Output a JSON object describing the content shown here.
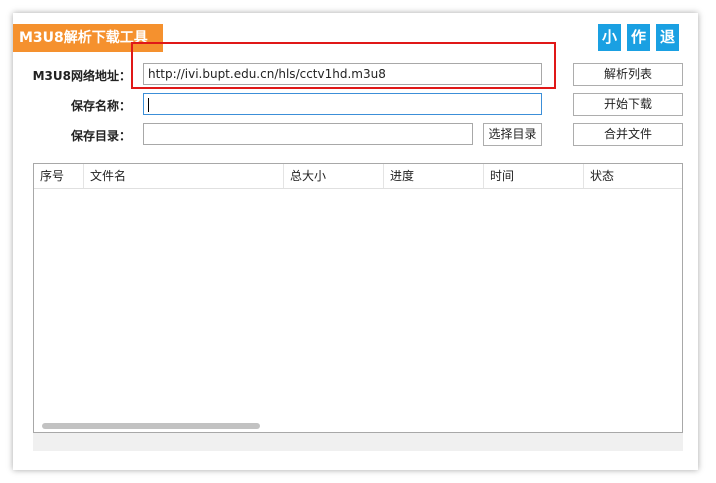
{
  "window": {
    "title": "M3U8解析下载工具",
    "controls": {
      "minimize": "小",
      "author": "作",
      "exit": "退"
    }
  },
  "form": {
    "url_label": "M3U8网络地址：",
    "url_value": "http://ivi.bupt.edu.cn/hls/cctv1hd.m3u8",
    "name_label": "保存名称：",
    "name_value": "",
    "dir_label": "保存目录：",
    "dir_value": ""
  },
  "buttons": {
    "parse": "解析列表",
    "start": "开始下载",
    "merge": "合并文件",
    "choose_dir": "选择目录"
  },
  "table": {
    "columns": [
      "序号",
      "文件名",
      "总大小",
      "进度",
      "时间",
      "状态"
    ],
    "rows": []
  },
  "colors": {
    "title_badge": "#f5912e",
    "window_buttons": "#1aa0e2",
    "highlight": "#e01818"
  }
}
